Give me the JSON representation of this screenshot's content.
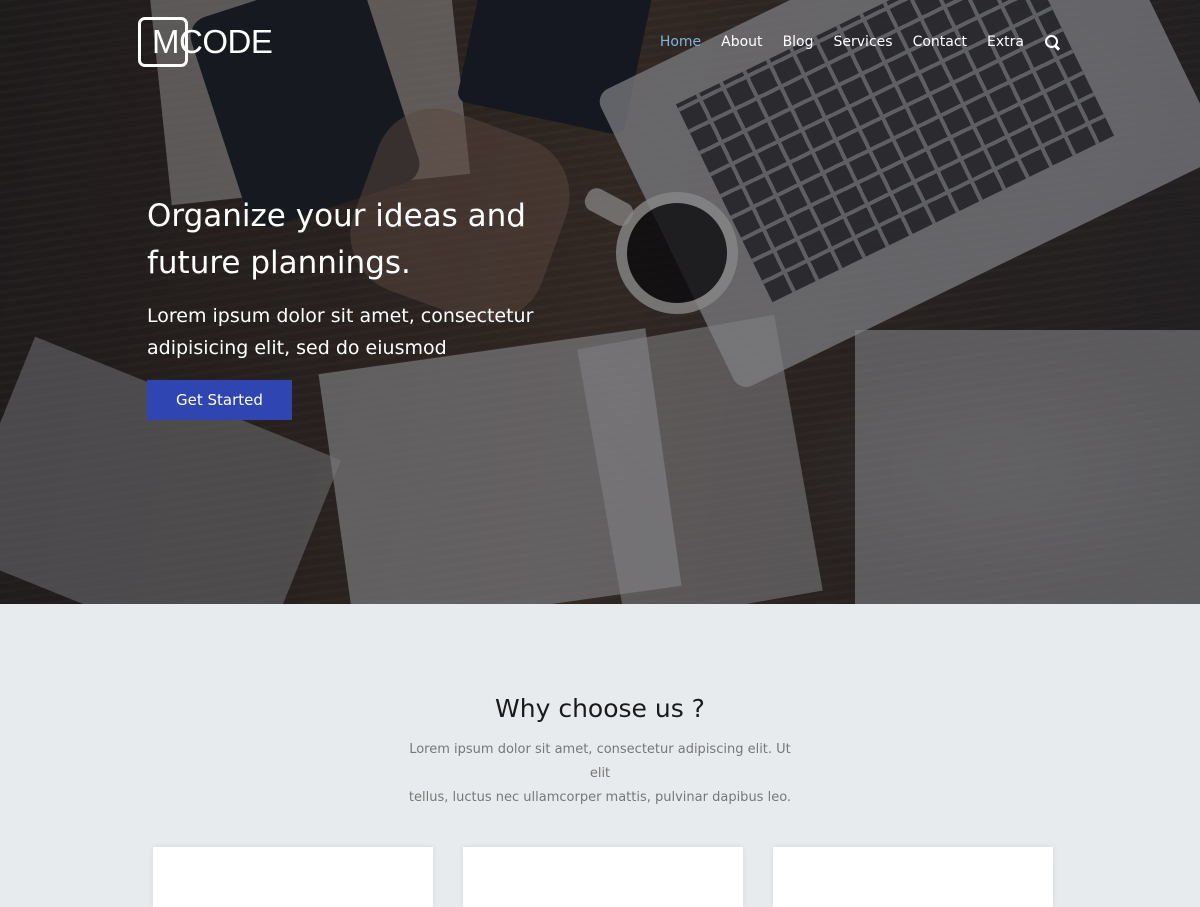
{
  "brand": {
    "logo_text": "MCODE"
  },
  "nav": {
    "items": [
      {
        "label": "Home",
        "active": true
      },
      {
        "label": "About"
      },
      {
        "label": "Blog"
      },
      {
        "label": "Services"
      },
      {
        "label": "Contact"
      },
      {
        "label": "Extra"
      }
    ],
    "search_icon": "search-icon",
    "active_color": "#7fb2e5"
  },
  "hero": {
    "title_line1": "Organize your ideas and",
    "title_line2": "future plannings.",
    "subtitle_line1": "Lorem ipsum dolor sit amet, consectetur",
    "subtitle_line2": "adipisicing elit, sed do eiusmod",
    "cta_label": "Get Started",
    "cta_color": "#2e45b2"
  },
  "features": {
    "title": "Why choose us ?",
    "description_line1": "Lorem ipsum dolor sit amet, consectetur adipiscing elit. Ut elit",
    "description_line2": "tellus, luctus nec ullamcorper mattis, pulvinar dapibus leo."
  }
}
